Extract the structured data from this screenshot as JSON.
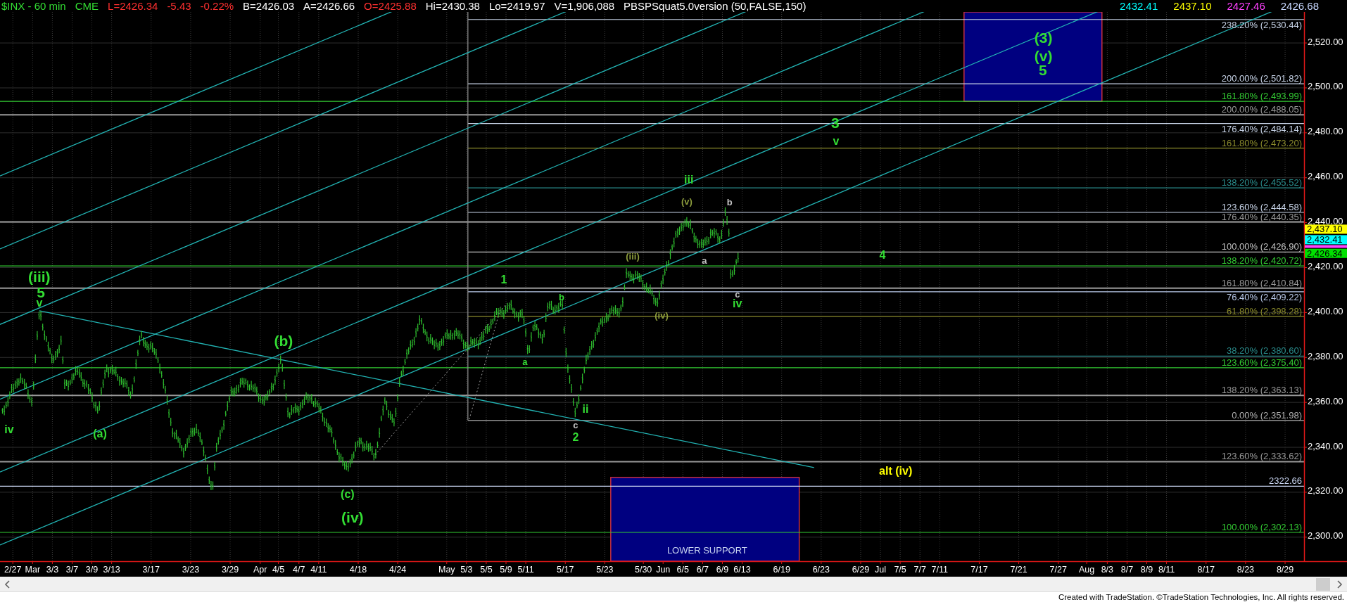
{
  "header": {
    "items": [
      {
        "text": "$INX - 60 min",
        "color": "#33dd33"
      },
      {
        "text": "CME",
        "color": "#33dd33"
      },
      {
        "text": "L=2426.34",
        "color": "#ff3030"
      },
      {
        "text": "-5.43",
        "color": "#ff3030"
      },
      {
        "text": "-0.22%",
        "color": "#ff3030"
      },
      {
        "text": "B=2426.03",
        "color": "#ffffff"
      },
      {
        "text": "A=2426.66",
        "color": "#ffffff"
      },
      {
        "text": "O=2425.88",
        "color": "#ff3030"
      },
      {
        "text": "Hi=2430.38",
        "color": "#ffffff"
      },
      {
        "text": "Lo=2419.97",
        "color": "#ffffff"
      },
      {
        "text": "V=1,906,088",
        "color": "#ffffff"
      },
      {
        "text": "PBSPSquat5.0version (50,FALSE,150)",
        "color": "#ffffff"
      }
    ],
    "indicator_values": [
      {
        "text": "2432.41",
        "color": "#00ffff"
      },
      {
        "text": "2437.10",
        "color": "#ffff00"
      },
      {
        "text": "2427.46",
        "color": "#ff40ff"
      },
      {
        "text": "2426.68",
        "color": "#c8d8ff"
      }
    ]
  },
  "chart": {
    "price_axis_labels": [
      "2,520.00",
      "2,500.00",
      "2,480.00",
      "2,460.00",
      "2,440.00",
      "2,420.00",
      "2,400.00",
      "2,380.00",
      "2,360.00",
      "2,340.00",
      "2,320.00",
      "2,300.00"
    ],
    "date_axis_labels": [
      "2/27",
      "Mar",
      "3/3",
      "3/7",
      "3/9",
      "3/13",
      "3/17",
      "3/23",
      "3/29",
      "Apr",
      "4/5",
      "4/7",
      "4/11",
      "4/18",
      "4/24",
      "May",
      "5/3",
      "5/5",
      "5/9",
      "5/11",
      "5/17",
      "5/23",
      "5/30",
      "Jun",
      "6/5",
      "6/7",
      "6/9",
      "6/13",
      "6/19",
      "6/23",
      "6/29",
      "Jul",
      "7/5",
      "7/7",
      "7/11",
      "7/17",
      "7/21",
      "7/27",
      "Aug",
      "8/3",
      "8/7",
      "8/9",
      "8/11",
      "8/17",
      "8/23",
      "8/29"
    ],
    "fib_levels": [
      {
        "label": "238.20% (2,530.44)",
        "color": "#c8d4e8"
      },
      {
        "label": "200.00% (2,501.82)",
        "color": "#c8d4e8"
      },
      {
        "label": "161.80% (2,493.99)",
        "color": "#33cc33"
      },
      {
        "label": "200.00% (2,488.05)",
        "color": "#9a9a9a"
      },
      {
        "label": "176.40% (2,484.14)",
        "color": "#c8d4e8"
      },
      {
        "label": "161.80% (2,473.20)",
        "color": "#8c8c2c"
      },
      {
        "label": "138.20% (2,455.52)",
        "color": "#2a8c8c"
      },
      {
        "label": "123.60% (2,444.58)",
        "color": "#c8d4e8"
      },
      {
        "label": "176.40% (2,440.35)",
        "color": "#9a9a9a"
      },
      {
        "label": "100.00% (2,426.90)",
        "color": "#c0c0c0"
      },
      {
        "label": "138.20% (2,420.72)",
        "color": "#33cc33"
      },
      {
        "label": "161.80% (2,410.84)",
        "color": "#9a9a9a"
      },
      {
        "label": "76.40% (2,409.22)",
        "color": "#b8c8e8"
      },
      {
        "label": "61.80% (2,398.28)",
        "color": "#8c8c2c"
      },
      {
        "label": "38.20% (2,380.60)",
        "color": "#2a8c8c"
      },
      {
        "label": "123.60% (2,375.40)",
        "color": "#33cc33"
      },
      {
        "label": "138.20% (2,363.13)",
        "color": "#9a9a9a"
      },
      {
        "label": "0.00% (2,351.98)",
        "color": "#b0b0b0"
      },
      {
        "label": "123.60% (2,333.62)",
        "color": "#9a9a9a"
      },
      {
        "label": "2322.66",
        "color": "#c8d4f0"
      },
      {
        "label": "100.00% (2,302.13)",
        "color": "#33cc33"
      }
    ],
    "price_tags": [
      {
        "label": "2,437.10",
        "color": "#ffff00"
      },
      {
        "label": "2,432.41",
        "color": "#00ffff"
      },
      {
        "color": "#ff40ff"
      },
      {
        "label": "2,426.34",
        "color": "#00e000"
      }
    ],
    "wave_labels": [
      {
        "text": "(iii)",
        "color": "#33dd33"
      },
      {
        "text": "5",
        "color": "#33dd33"
      },
      {
        "text": "v",
        "color": "#33dd33"
      },
      {
        "text": "iv",
        "color": "#33dd33"
      },
      {
        "text": "(a)",
        "color": "#33dd33"
      },
      {
        "text": "(b)",
        "color": "#33dd33"
      },
      {
        "text": "(c)",
        "color": "#33dd33"
      },
      {
        "text": "(iv)",
        "color": "#33dd33"
      },
      {
        "text": "1",
        "color": "#33dd33"
      },
      {
        "text": "a",
        "color": "#33dd33"
      },
      {
        "text": "b",
        "color": "#33dd33"
      },
      {
        "text": "c",
        "color": "#c0c0c0"
      },
      {
        "text": "2",
        "color": "#33dd33"
      },
      {
        "text": "ii",
        "color": "#33dd33"
      },
      {
        "text": "(iii)",
        "color": "#8c9c3c"
      },
      {
        "text": "(iv)",
        "color": "#8c9c3c"
      },
      {
        "text": "(v)",
        "color": "#8c9c3c"
      },
      {
        "text": "iii",
        "color": "#33dd33"
      },
      {
        "text": "a",
        "color": "#c0c0c0"
      },
      {
        "text": "b",
        "color": "#c0c0c0"
      },
      {
        "text": "c",
        "color": "#c0c0c0"
      },
      {
        "text": "iv",
        "color": "#33dd33"
      },
      {
        "text": "3",
        "color": "#33dd33"
      },
      {
        "text": "v",
        "color": "#33dd33"
      },
      {
        "text": "4",
        "color": "#33dd33"
      },
      {
        "text": "(3)",
        "color": "#33dd33"
      },
      {
        "text": "(v)",
        "color": "#33dd33"
      },
      {
        "text": "5",
        "color": "#33dd33"
      },
      {
        "text": "alt (iv)",
        "color": "#ffff00"
      }
    ],
    "zone_label": "LOWER SUPPORT"
  },
  "footer": {
    "text": "Created with TradeStation. ©TradeStation Technologies, Inc. All rights reserved."
  }
}
